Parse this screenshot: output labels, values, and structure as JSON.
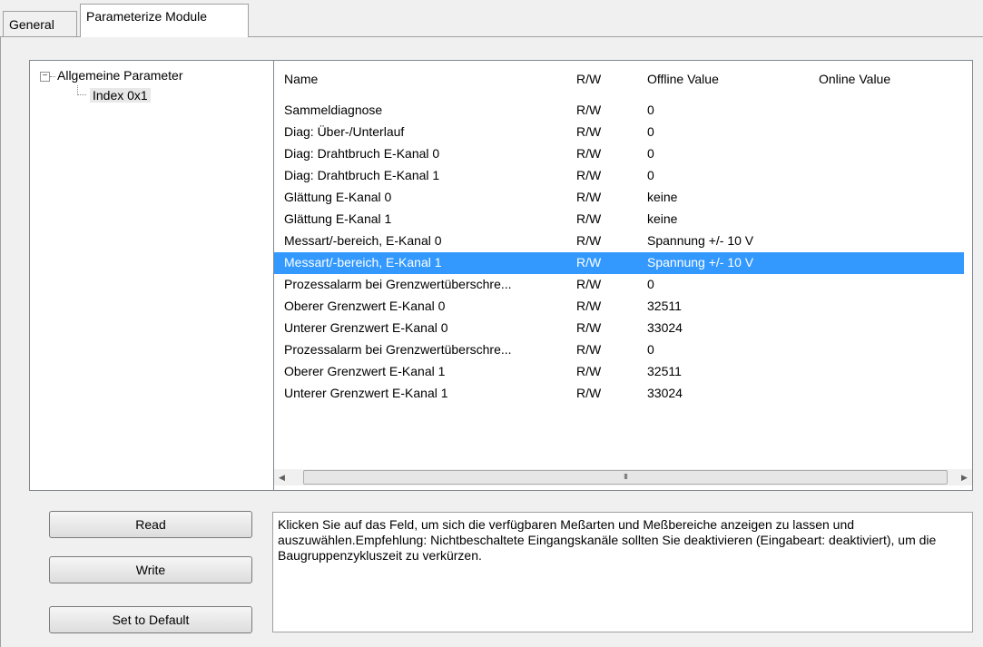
{
  "tabs": {
    "general": "General",
    "parameterize": "Parameterize Module"
  },
  "tree": {
    "root": "Allgemeine Parameter",
    "expander": "−",
    "child": "Index 0x1"
  },
  "grid": {
    "columns": {
      "name": "Name",
      "rw": "R/W",
      "offline": "Offline Value",
      "online": "Online Value"
    },
    "rows": [
      {
        "name": "Sammeldiagnose",
        "rw": "R/W",
        "offline": "0",
        "online": ""
      },
      {
        "name": "Diag: Über-/Unterlauf",
        "rw": "R/W",
        "offline": "0",
        "online": ""
      },
      {
        "name": "Diag: Drahtbruch E-Kanal 0",
        "rw": "R/W",
        "offline": "0",
        "online": ""
      },
      {
        "name": "Diag: Drahtbruch E-Kanal 1",
        "rw": "R/W",
        "offline": "0",
        "online": ""
      },
      {
        "name": "Glättung E-Kanal 0",
        "rw": "R/W",
        "offline": "keine",
        "online": ""
      },
      {
        "name": "Glättung E-Kanal 1",
        "rw": "R/W",
        "offline": "keine",
        "online": ""
      },
      {
        "name": "Messart/-bereich, E-Kanal 0",
        "rw": "R/W",
        "offline": "Spannung +/- 10 V",
        "online": ""
      },
      {
        "name": "Messart/-bereich, E-Kanal 1",
        "rw": "R/W",
        "offline": "Spannung +/- 10 V",
        "online": ""
      },
      {
        "name": "Prozessalarm bei Grenzwertüberschre...",
        "rw": "R/W",
        "offline": "0",
        "online": ""
      },
      {
        "name": "Oberer Grenzwert E-Kanal 0",
        "rw": "R/W",
        "offline": "32511",
        "online": ""
      },
      {
        "name": "Unterer Grenzwert E-Kanal 0",
        "rw": "R/W",
        "offline": "33024",
        "online": ""
      },
      {
        "name": "Prozessalarm bei Grenzwertüberschre...",
        "rw": "R/W",
        "offline": "0",
        "online": ""
      },
      {
        "name": "Oberer Grenzwert E-Kanal 1",
        "rw": "R/W",
        "offline": "32511",
        "online": ""
      },
      {
        "name": "Unterer Grenzwert E-Kanal 1",
        "rw": "R/W",
        "offline": "33024",
        "online": ""
      }
    ],
    "selected_row": 7,
    "scroll": {
      "left": "◀",
      "right": "▶",
      "thumb": "III"
    }
  },
  "buttons": {
    "read": "Read",
    "write": "Write",
    "default": "Set to Default"
  },
  "description": "Klicken Sie auf das Feld, um sich die verfügbaren Meßarten und Meßbereiche anzeigen zu lassen und auszuwählen.Empfehlung: Nichtbeschaltete Eingangskanäle sollten Sie deaktivieren (Eingabeart: deaktiviert), um die Baugruppenzykluszeit zu verkürzen.",
  "colors": {
    "selection": "#3399ff",
    "panel": "#f0f0f0"
  }
}
